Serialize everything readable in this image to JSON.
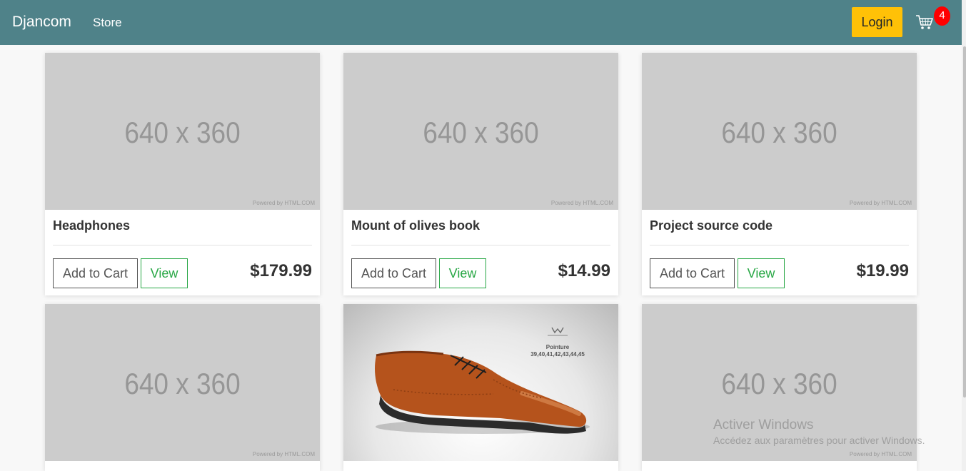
{
  "navbar": {
    "brand": "Djancom",
    "links": [
      "Store"
    ],
    "login_label": "Login",
    "cart_count": "4",
    "cart_icon": "shopping-cart-icon",
    "colors": {
      "background": "#4f8289",
      "login": "#ffc107",
      "badge": "#ff0000"
    }
  },
  "products": [
    {
      "title": "Headphones",
      "price": "$179.99",
      "placeholder": "640 x 360",
      "powered": "Powered by HTML.COM",
      "add_label": "Add to Cart",
      "view_label": "View"
    },
    {
      "title": "Mount of olives book",
      "price": "$14.99",
      "placeholder": "640 x 360",
      "powered": "Powered by HTML.COM",
      "add_label": "Add to Cart",
      "view_label": "View"
    },
    {
      "title": "Project source code",
      "price": "$19.99",
      "placeholder": "640 x 360",
      "powered": "Powered by HTML.COM",
      "add_label": "Add to Cart",
      "view_label": "View"
    },
    {
      "placeholder": "640 x 360",
      "powered": "Powered by HTML.COM"
    },
    {
      "image": "shoe-photo",
      "image_text": [
        "Pointure",
        "39,40,41,42,43,44,45"
      ]
    },
    {
      "placeholder": "640 x 360",
      "powered": "Powered by HTML.COM"
    }
  ],
  "watermark": {
    "line1": "Activer Windows",
    "line2": "Accédez aux paramètres pour activer Windows."
  }
}
